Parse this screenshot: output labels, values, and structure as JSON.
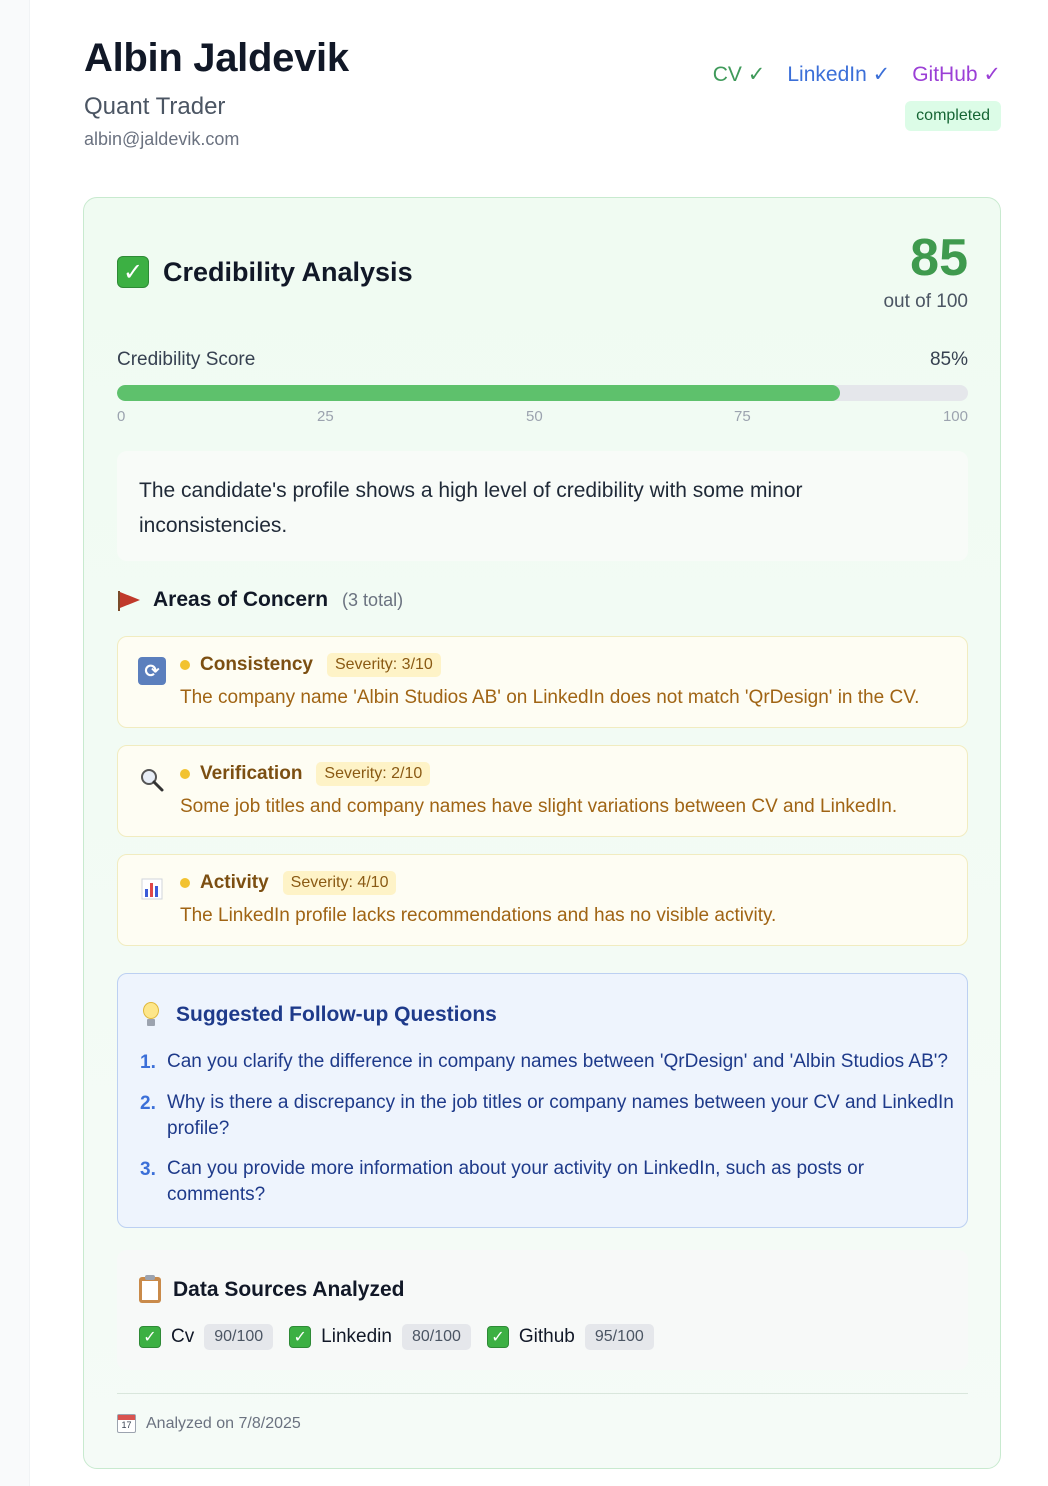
{
  "candidate": {
    "name": "Albin Jaldevik",
    "title": "Quant Trader",
    "email": "albin@jaldevik.com"
  },
  "header_links": [
    {
      "label": "CV ✓",
      "color": "#3f9a5a"
    },
    {
      "label": "LinkedIn ✓",
      "color": "#3b6fd8"
    },
    {
      "label": "GitHub ✓",
      "color": "#9b3fd6"
    }
  ],
  "status": "completed",
  "analysis": {
    "title": "Credibility Analysis",
    "score": "85",
    "score_sub": "out of 100",
    "score_label": "Credibility Score",
    "score_pct": "85%",
    "progress_value": 0.85,
    "ticks": [
      "0",
      "25",
      "50",
      "75",
      "100"
    ],
    "summary": "The candidate's profile shows a high level of credibility with some minor inconsistencies."
  },
  "concerns": {
    "title": "Areas of Concern",
    "count": "(3 total)",
    "items": [
      {
        "icon": "cycle-icon",
        "name": "Consistency",
        "severity": "Severity: 3/10",
        "description": "The company name 'Albin Studios AB' on LinkedIn does not match 'QrDesign' in the CV."
      },
      {
        "icon": "magnifier-icon",
        "name": "Verification",
        "severity": "Severity: 2/10",
        "description": "Some job titles and company names have slight variations between CV and LinkedIn."
      },
      {
        "icon": "bar-chart-icon",
        "name": "Activity",
        "severity": "Severity: 4/10",
        "description": "The LinkedIn profile lacks recommendations and has no visible activity."
      }
    ]
  },
  "questions": {
    "title": "Suggested Follow-up Questions",
    "items": [
      {
        "num": "1.",
        "text": "Can you clarify the difference in company names between 'QrDesign' and 'Albin Studios AB'?"
      },
      {
        "num": "2.",
        "text": "Why is there a discrepancy in the job titles or company names between your CV and LinkedIn profile?"
      },
      {
        "num": "3.",
        "text": "Can you provide more information about your activity on LinkedIn, such as posts or comments?"
      }
    ]
  },
  "sources": {
    "title": "Data Sources Analyzed",
    "items": [
      {
        "name": "Cv",
        "score": "90/100"
      },
      {
        "name": "Linkedin",
        "score": "80/100"
      },
      {
        "name": "Github",
        "score": "95/100"
      }
    ]
  },
  "footer": {
    "analyzed_on": "Analyzed on 7/8/2025",
    "calendar_day": "17"
  }
}
